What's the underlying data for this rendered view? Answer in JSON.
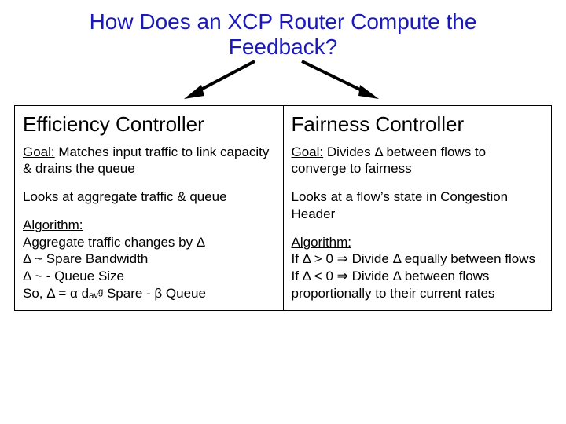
{
  "title": "How Does an XCP Router Compute the Feedback?",
  "left": {
    "heading": "Efficiency Controller",
    "goal_label": "Goal:",
    "goal_text": " Matches input traffic to link capacity & drains the queue",
    "looks": "Looks at aggregate traffic & queue",
    "alg_label": "Algorithm:",
    "alg_l1": "Aggregate traffic changes by Δ",
    "alg_l2": "Δ ~ Spare Bandwidth",
    "alg_l3": "Δ ~ - Queue Size",
    "alg_l4": "So, Δ = α dₐᵥᵍ Spare - β Queue"
  },
  "right": {
    "heading": "Fairness Controller",
    "goal_label": "Goal:",
    "goal_text": " Divides Δ between flows to converge to fairness",
    "looks": "Looks at a flow’s state in Congestion Header",
    "alg_label": "Algorithm:",
    "alg_l1": "If Δ > 0 ⇒ Divide Δ equally between flows",
    "alg_l2": "If Δ < 0 ⇒ Divide Δ between flows proportionally to their current rates"
  },
  "icons": {
    "arrow_sw": "arrow-southwest-icon",
    "arrow_se": "arrow-southeast-icon"
  }
}
